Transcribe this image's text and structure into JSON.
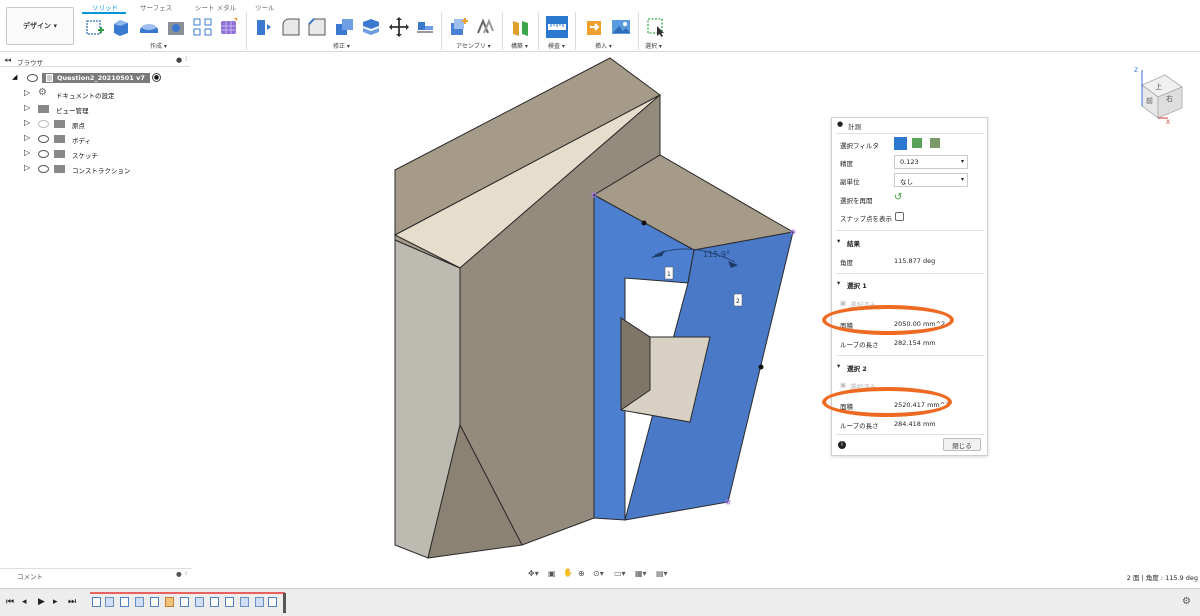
{
  "toolbar": {
    "design_label": "デザイン ▾",
    "tabs": [
      "ソリッド",
      "サーフェス",
      "シート メタル",
      "ツール"
    ],
    "groups": [
      "作成 ▾",
      "修正 ▾",
      "アセンブリ ▾",
      "構築 ▾",
      "検査 ▾",
      "挿入 ▾",
      "選択 ▾"
    ]
  },
  "browser": {
    "title": "ブラウザ",
    "root": "Question2_20210501 v7",
    "items": [
      "ドキュメントの設定",
      "ビュー管理",
      "原点",
      "ボディ",
      "スケッチ",
      "コンストラクション"
    ]
  },
  "viewcube": {
    "top": "上",
    "front": "前",
    "right": "右",
    "axis_z": "Z",
    "axis_x": "X"
  },
  "dimension": {
    "angle": "115.9°",
    "label1": "1",
    "label2": "2"
  },
  "measure": {
    "title": "計測",
    "filter_label": "選択フィルタ",
    "precision_label": "精度",
    "precision_value": "0.123",
    "subunit_label": "副単位",
    "subunit_value": "なし",
    "reselect_label": "選択を再開",
    "snap_label": "スナップ点を表示",
    "results_header": "結果",
    "angle_label": "角度",
    "angle_value": "115.877 deg",
    "sel1_header": "選択 1",
    "sel1_status": "選択済み",
    "area_label": "面積",
    "sel1_area": "2050.00 mm^2",
    "loop_label": "ループの長さ",
    "sel1_loop": "282.154 mm",
    "sel2_header": "選択 2",
    "sel2_status": "選択済み",
    "sel2_area": "2520.417 mm^2",
    "sel2_loop": "284.418 mm",
    "close_label": "閉じる"
  },
  "comments": {
    "label": "コメント"
  },
  "status": {
    "text": "2 面 | 角度 : 115.9 deg"
  },
  "colors": {
    "accent": "#0696d7",
    "face_blue": "#4d7fd0",
    "annotation": "#ee6a22",
    "body": "#a49b8c"
  }
}
